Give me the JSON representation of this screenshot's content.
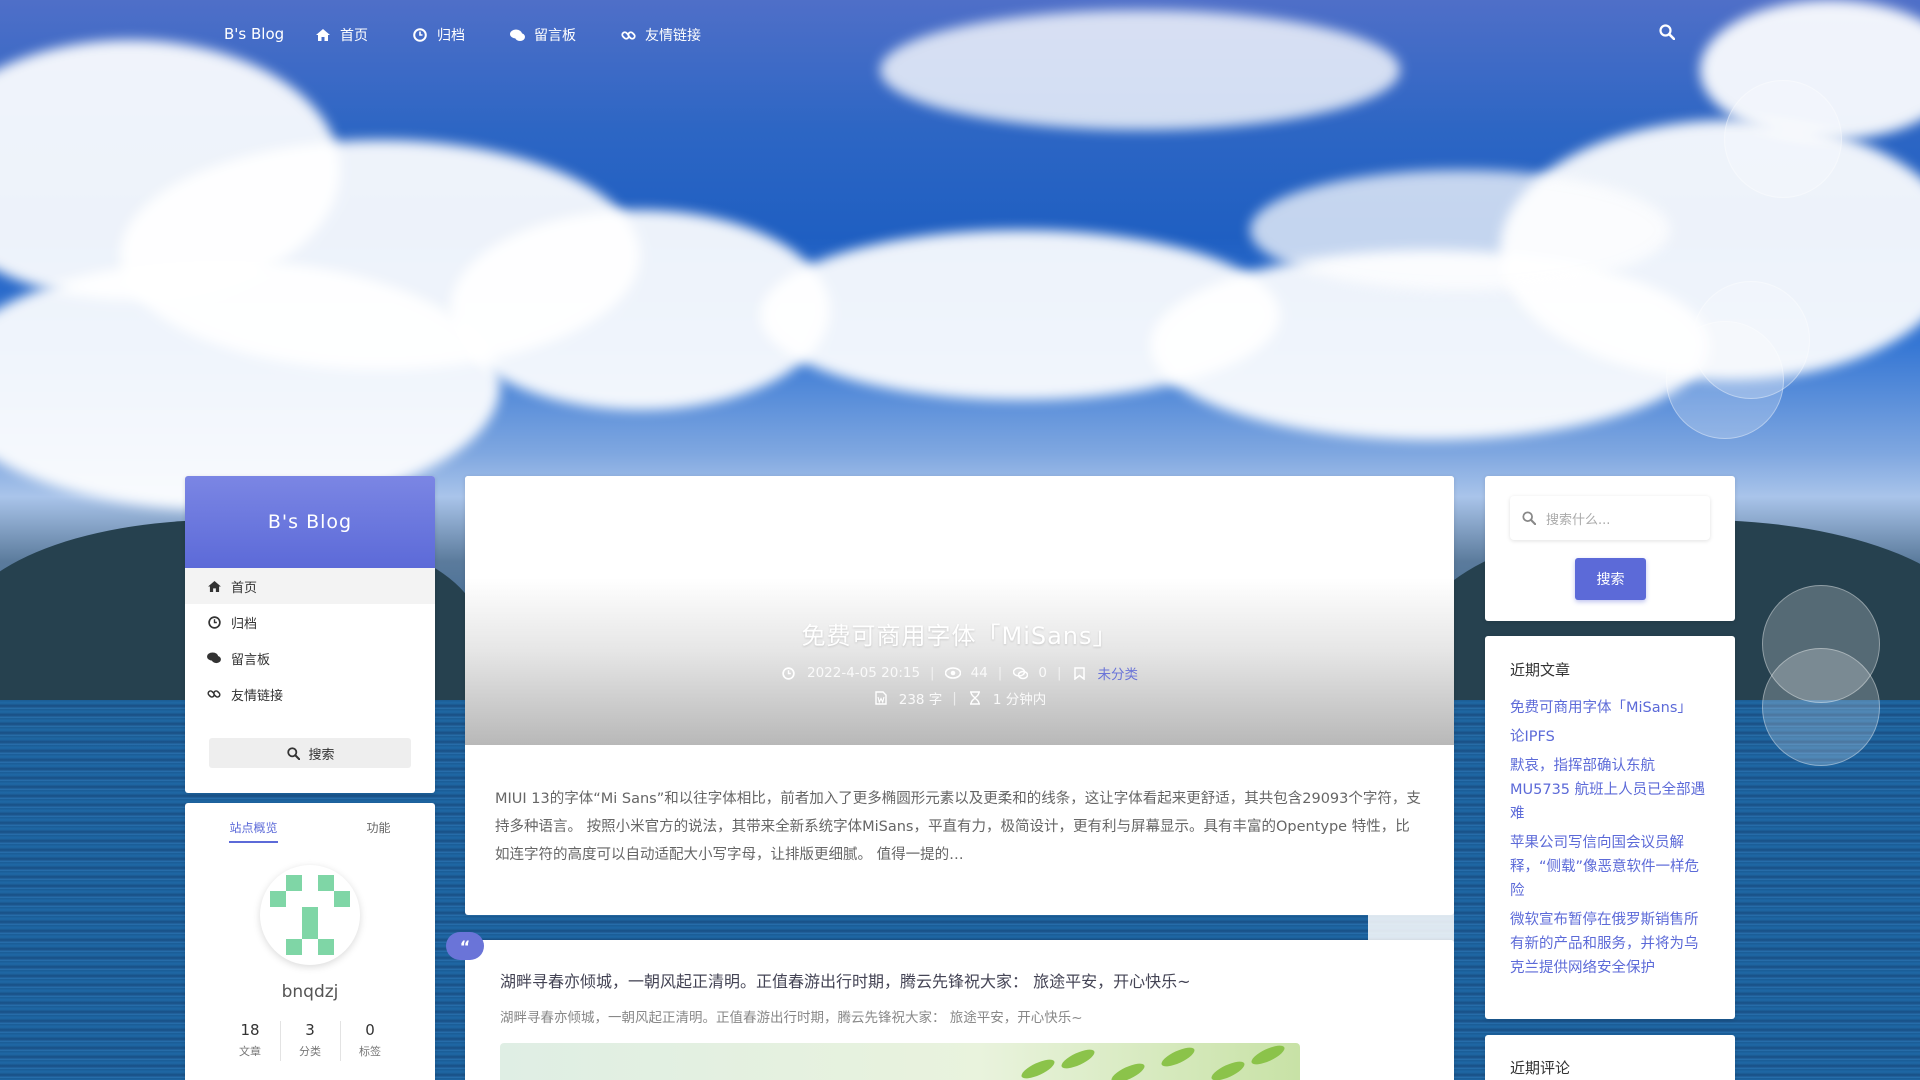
{
  "nav": {
    "brand": "B's Blog",
    "links": [
      {
        "icon": "home-icon",
        "label": "首页"
      },
      {
        "icon": "clock-icon",
        "label": "归档"
      },
      {
        "icon": "comments-icon",
        "label": "留言板"
      },
      {
        "icon": "link-icon",
        "label": "友情链接"
      }
    ],
    "search_icon": "search-icon"
  },
  "sidebar": {
    "title": "B's Blog",
    "menu": [
      {
        "icon": "home-icon",
        "label": "首页"
      },
      {
        "icon": "clock-icon",
        "label": "归档"
      },
      {
        "icon": "comments-icon",
        "label": "留言板"
      },
      {
        "icon": "link-icon",
        "label": "友情链接"
      }
    ],
    "search_label": "搜索"
  },
  "profile": {
    "tabs": [
      "站点概览",
      "功能"
    ],
    "username": "bnqdzj",
    "stats": [
      {
        "value": "18",
        "label": "文章"
      },
      {
        "value": "3",
        "label": "分类"
      },
      {
        "value": "0",
        "label": "标签"
      }
    ]
  },
  "post": {
    "title": "免费可商用字体「MiSans」",
    "date": "2022-4-05 20:15",
    "views": "44",
    "comments": "0",
    "category": "未分类",
    "words": "238 字",
    "read_time": "1 分钟内",
    "excerpt": "MIUI 13的字体“Mi Sans”和以往字体相比，前者加入了更多椭圆形元素以及更柔和的线条，这让字体看起来更舒适，其共包含29093个字符，支持多种语言。 按照小米官方的说法，其带来全新系统字体MiSans，平直有力，极简设计，更有利与屏幕显示。具有丰富的Opentype 特性，比如连字符的高度可以自动适配大小写字母，让排版更细腻。 值得一提的…"
  },
  "quote": {
    "badge": "“",
    "title": "湖畔寻春亦倾城，一朝风起正清明。正值春游出行时期，腾云先锋祝大家： 旅途平安，开心快乐~",
    "summary": "湖畔寻春亦倾城，一朝风起正清明。正值春游出行时期，腾云先锋祝大家： 旅途平安，开心快乐~"
  },
  "right_search": {
    "placeholder": "搜索什么...",
    "button": "搜索"
  },
  "recent": {
    "title": "近期文章",
    "items": [
      "免费可商用字体「MiSans」",
      "论IPFS",
      "默哀，指挥部确认东航MU5735 航班上人员已全部遇难",
      "苹果公司写信向国会议员解释，“侧载”像恶意软件一样危险",
      "微软宣布暂停在俄罗斯销售所有新的产品和服务，并将为乌克兰提供网络安全保护"
    ]
  },
  "comments": {
    "title": "近期评论"
  },
  "colors": {
    "accent": "#5c6ad8",
    "link": "#5c6ad8",
    "avatar_green": "#7fd6a6"
  }
}
